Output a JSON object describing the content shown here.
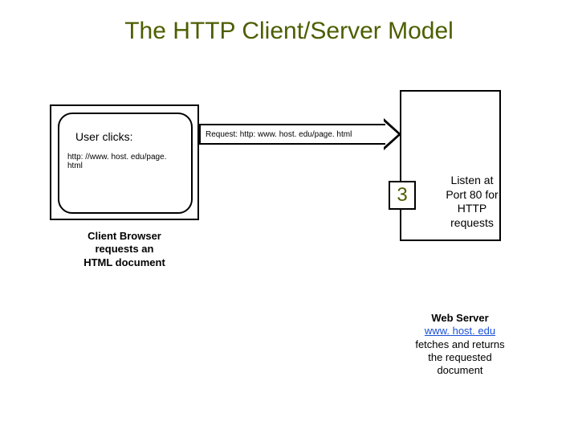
{
  "title": "The HTTP Client/Server Model",
  "client": {
    "user_clicks_label": "User clicks:",
    "url": "http: //www. host. edu/page. html",
    "caption_line1": "Client Browser",
    "caption_line2": "requests an",
    "caption_line3": "HTML document"
  },
  "request": {
    "label": "Request: http: www. host. edu/page. html"
  },
  "server": {
    "badge": "3",
    "listen_line1": "Listen at",
    "listen_line2": "Port 80 for",
    "listen_line3": "HTTP",
    "listen_line4": "requests",
    "caption_bold": "Web Server",
    "caption_link": "www. host. edu",
    "caption_line3": "fetches and returns",
    "caption_line4": "the requested",
    "caption_line5": "document"
  }
}
